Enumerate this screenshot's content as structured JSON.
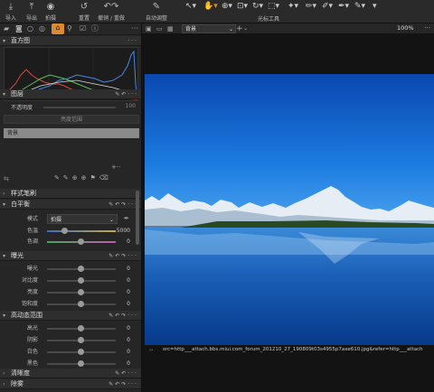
{
  "toolbar": {
    "buttons": [
      {
        "icon": "import-icon",
        "glyph": "⤓",
        "label": "导入"
      },
      {
        "icon": "export-icon",
        "glyph": "⤒",
        "label": "导出"
      },
      {
        "icon": "camera-icon",
        "glyph": "◉",
        "label": "拍摄"
      },
      {
        "icon": "reset-icon",
        "glyph": "↺",
        "label": "重置"
      },
      {
        "icon": "undo-redo-icon",
        "glyph": "↶↷",
        "label": "撤销 / 重做"
      },
      {
        "icon": "auto-adjust-icon",
        "glyph": "✎",
        "label": "自动调整"
      }
    ],
    "cursor_tools_label": "光标工具"
  },
  "left_tabs": [
    "folder-icon",
    "camera-icon",
    "circle-icon",
    "adjust-icon",
    "search-icon",
    "check-icon",
    "info-icon"
  ],
  "histogram": {
    "title": "直方图"
  },
  "layers": {
    "title": "图层",
    "opacity_label": "不透明度",
    "opacity_value": "100",
    "range_button": "亮度范围",
    "layer_name": "背景"
  },
  "style_brush": {
    "title": "样式笔刷"
  },
  "white_balance": {
    "title": "白平衡",
    "mode_label": "模式",
    "mode_value": "拍摄",
    "temp_label": "色温",
    "temp_value": "5000",
    "tint_label": "色调",
    "tint_value": "0"
  },
  "exposure": {
    "title": "曝光",
    "rows": [
      {
        "label": "曝光",
        "value": "0"
      },
      {
        "label": "对比度",
        "value": "0"
      },
      {
        "label": "亮度",
        "value": "0"
      },
      {
        "label": "饱和度",
        "value": "0"
      }
    ]
  },
  "hdr": {
    "title": "高动态范围",
    "rows": [
      {
        "label": "高光",
        "value": "0"
      },
      {
        "label": "阴影",
        "value": "0"
      },
      {
        "label": "白色",
        "value": "0"
      },
      {
        "label": "黑色",
        "value": "0"
      }
    ]
  },
  "clarity": {
    "title": "清晰度"
  },
  "dehaze": {
    "title": "除雾"
  },
  "viewer": {
    "layer_select": "背景",
    "zoom": "100%",
    "filename": "src=http___attach.bbs.miui.com_forum_201210_27_190809t03s4955p7axe610.jpg&refer=http___attach"
  }
}
